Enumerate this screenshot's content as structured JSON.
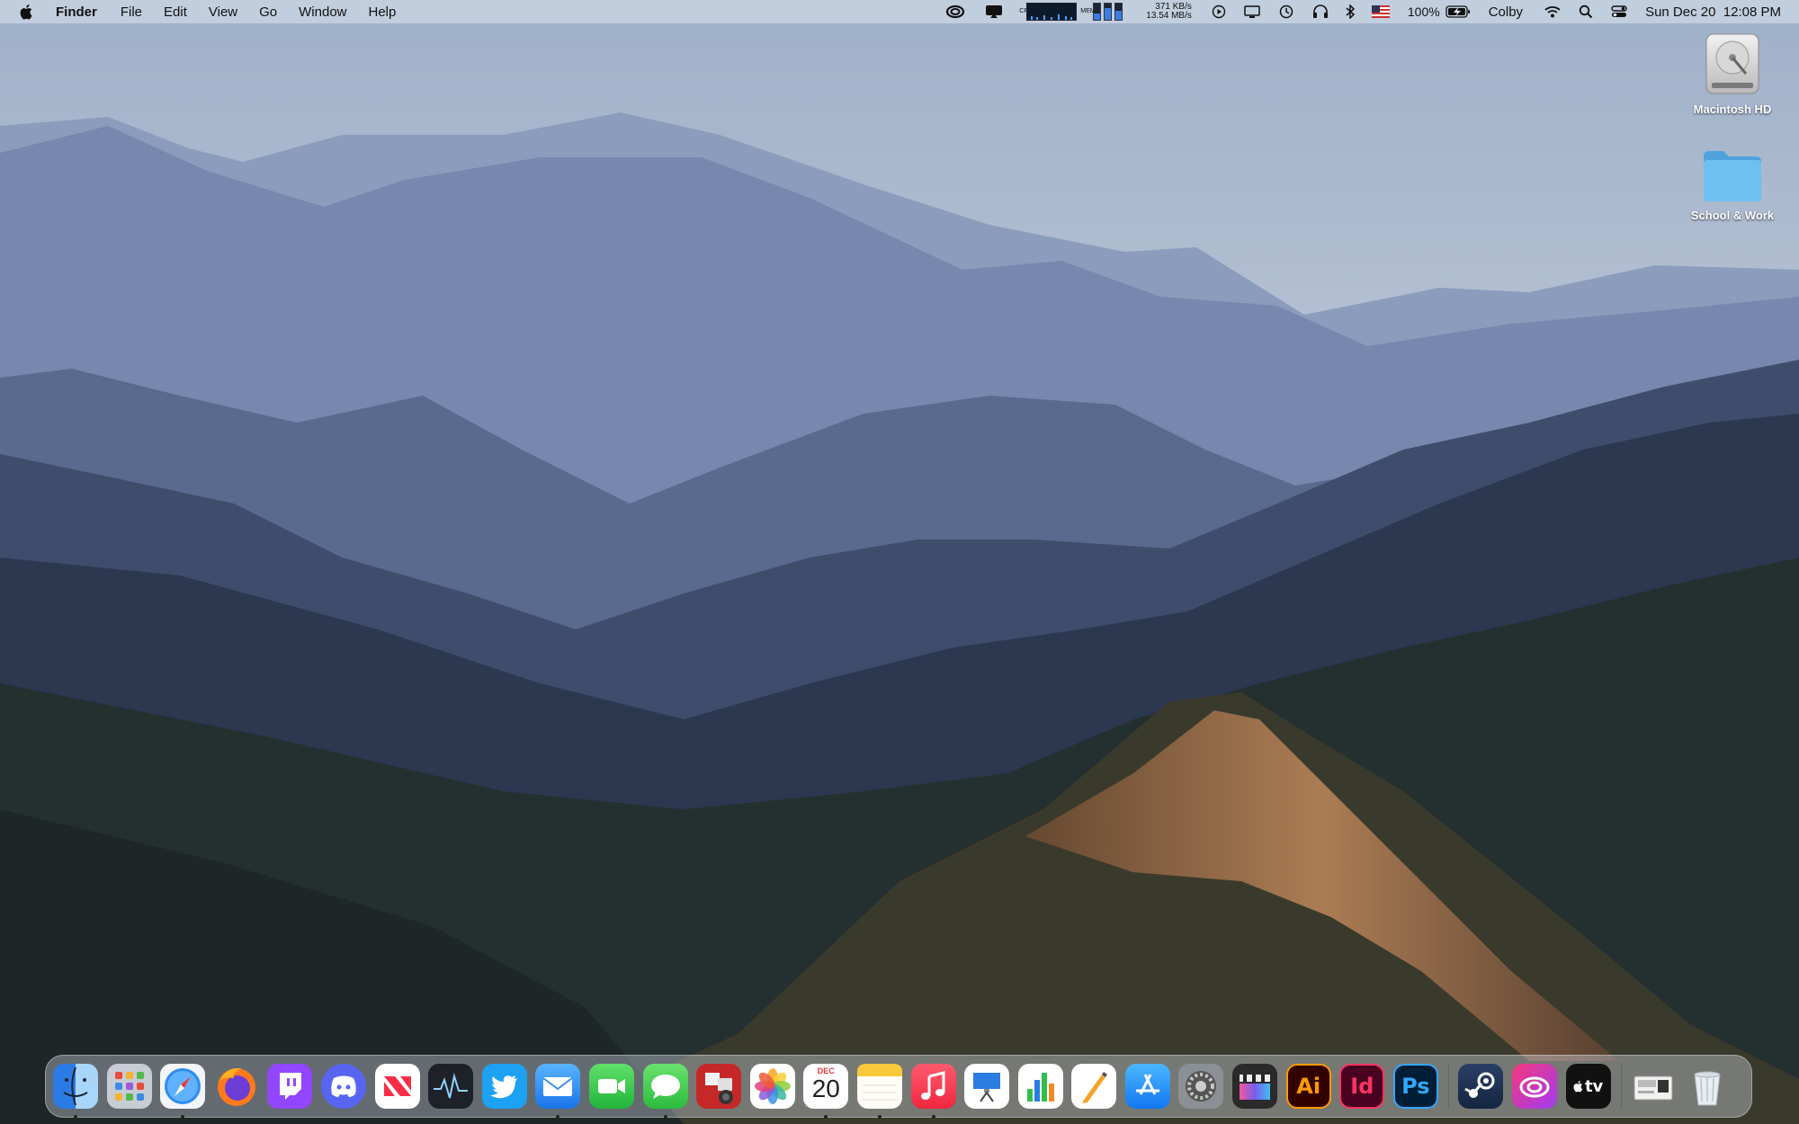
{
  "menubar": {
    "app_name": "Finder",
    "menus": [
      "File",
      "Edit",
      "View",
      "Go",
      "Window",
      "Help"
    ],
    "status": {
      "net_up": "371 KB/s",
      "net_down": "13.54 MB/s",
      "battery": "100%",
      "user": "Colby",
      "datetime": "Sun Dec 20  12:08 PM",
      "cpu_label": "CPU",
      "mem_label": "MEM"
    }
  },
  "desktop": {
    "icons": [
      {
        "label": "Macintosh HD",
        "icon": "hard-drive-icon"
      },
      {
        "label": "School & Work",
        "icon": "folder-icon"
      }
    ]
  },
  "dock": {
    "calendar": {
      "month": "DEC",
      "day": "20"
    },
    "items": [
      {
        "name": "Finder",
        "icon": "finder-icon",
        "running": true
      },
      {
        "name": "Launchpad",
        "icon": "launchpad-icon",
        "running": false
      },
      {
        "name": "Safari",
        "icon": "safari-icon",
        "running": true
      },
      {
        "name": "Firefox",
        "icon": "firefox-icon",
        "running": false
      },
      {
        "name": "Twitch",
        "icon": "twitch-icon",
        "running": false
      },
      {
        "name": "Discord",
        "icon": "discord-icon",
        "running": false
      },
      {
        "name": "News",
        "icon": "news-icon",
        "running": false
      },
      {
        "name": "Activity Monitor",
        "icon": "activity-monitor-icon",
        "running": false
      },
      {
        "name": "Twitter",
        "icon": "twitter-icon",
        "running": false
      },
      {
        "name": "Mail",
        "icon": "mail-icon",
        "running": true
      },
      {
        "name": "FaceTime",
        "icon": "facetime-icon",
        "running": false
      },
      {
        "name": "Messages",
        "icon": "messages-icon",
        "running": true
      },
      {
        "name": "Photo Booth",
        "icon": "photo-booth-icon",
        "running": false
      },
      {
        "name": "Photos",
        "icon": "photos-icon",
        "running": false
      },
      {
        "name": "Calendar",
        "icon": "calendar-icon",
        "running": true
      },
      {
        "name": "Notes",
        "icon": "notes-icon",
        "running": true
      },
      {
        "name": "Music",
        "icon": "music-icon",
        "running": true
      },
      {
        "name": "Keynote",
        "icon": "keynote-icon",
        "running": false
      },
      {
        "name": "Numbers",
        "icon": "numbers-icon",
        "running": false
      },
      {
        "name": "Pages",
        "icon": "pages-icon",
        "running": false
      },
      {
        "name": "App Store",
        "icon": "app-store-icon",
        "running": false
      },
      {
        "name": "System Preferences",
        "icon": "system-preferences-icon",
        "running": false
      },
      {
        "name": "Final Cut Pro",
        "icon": "final-cut-pro-icon",
        "running": false
      },
      {
        "name": "Illustrator",
        "icon": "illustrator-icon",
        "text": "Ai",
        "running": false
      },
      {
        "name": "InDesign",
        "icon": "indesign-icon",
        "text": "Id",
        "running": false
      },
      {
        "name": "Photoshop",
        "icon": "photoshop-icon",
        "text": "Ps",
        "running": false
      },
      {
        "name": "Steam",
        "icon": "steam-icon",
        "running": false
      },
      {
        "name": "Creative Cloud",
        "icon": "creative-cloud-icon",
        "running": false
      },
      {
        "name": "Apple TV",
        "icon": "apple-tv-icon",
        "text": "tv",
        "running": false
      },
      {
        "name": "Downloads Stack",
        "icon": "downloads-stack-icon",
        "running": false
      },
      {
        "name": "Trash",
        "icon": "trash-icon",
        "running": false
      }
    ]
  }
}
